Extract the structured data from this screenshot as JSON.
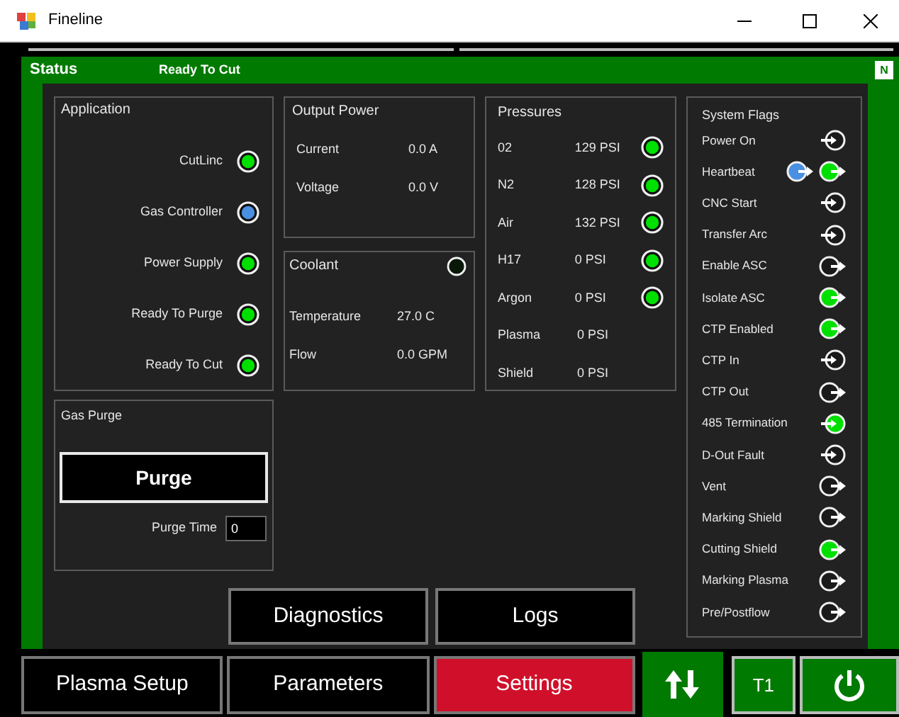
{
  "window": {
    "title": "Fineline"
  },
  "header": {
    "title": "Status",
    "status": "Ready To Cut",
    "badge": "N"
  },
  "application": {
    "title": "Application",
    "items": [
      {
        "label": "CutLinc",
        "color": "#00e000"
      },
      {
        "label": "Gas Controller",
        "color": "#4a90e2"
      },
      {
        "label": "Power Supply",
        "color": "#00e000"
      },
      {
        "label": "Ready To Purge",
        "color": "#00e000"
      },
      {
        "label": "Ready To Cut",
        "color": "#00e000"
      }
    ]
  },
  "output_power": {
    "title": "Output Power",
    "rows": [
      {
        "label": "Current",
        "value": "0.0 A"
      },
      {
        "label": "Voltage",
        "value": "0.0 V"
      }
    ]
  },
  "coolant": {
    "title": "Coolant",
    "color": "#0a180a",
    "rows": [
      {
        "label": "Temperature",
        "value": "27.0 C"
      },
      {
        "label": "Flow",
        "value": "0.0 GPM"
      }
    ]
  },
  "pressures": {
    "title": "Pressures",
    "rows": [
      {
        "label": "02",
        "value": "129 PSI",
        "color": "#00e000"
      },
      {
        "label": "N2",
        "value": "128 PSI",
        "color": "#00e000"
      },
      {
        "label": "Air",
        "value": "132 PSI",
        "color": "#00e000"
      },
      {
        "label": "H17",
        "value": "0 PSI",
        "color": "#00e000"
      },
      {
        "label": "Argon",
        "value": "0 PSI",
        "color": "#00e000"
      },
      {
        "label": "Plasma",
        "value": "0 PSI"
      },
      {
        "label": "Shield",
        "value": "0 PSI"
      }
    ]
  },
  "system_flags": {
    "title": "System Flags",
    "items": [
      {
        "label": "Power On",
        "indicators": [
          {
            "kind": "in",
            "color": "#1a1a1a"
          }
        ]
      },
      {
        "label": "Heartbeat",
        "indicators": [
          {
            "kind": "out",
            "color": "#4a90e2"
          },
          {
            "kind": "out",
            "color": "#00e000"
          }
        ]
      },
      {
        "label": "CNC Start",
        "indicators": [
          {
            "kind": "in",
            "color": "#1a1a1a"
          }
        ]
      },
      {
        "label": "Transfer Arc",
        "indicators": [
          {
            "kind": "in",
            "color": "#1a1a1a"
          }
        ]
      },
      {
        "label": "Enable ASC",
        "indicators": [
          {
            "kind": "out",
            "color": "#1a1a1a"
          }
        ]
      },
      {
        "label": "Isolate ASC",
        "indicators": [
          {
            "kind": "out",
            "color": "#00e000"
          }
        ]
      },
      {
        "label": "CTP Enabled",
        "indicators": [
          {
            "kind": "out",
            "color": "#00e000"
          }
        ]
      },
      {
        "label": "CTP In",
        "indicators": [
          {
            "kind": "in",
            "color": "#1a1a1a"
          }
        ]
      },
      {
        "label": "CTP Out",
        "indicators": [
          {
            "kind": "out",
            "color": "#1a1a1a"
          }
        ]
      },
      {
        "label": "485 Termination",
        "indicators": [
          {
            "kind": "in",
            "color": "#00e000"
          }
        ]
      },
      {
        "label": "D-Out Fault",
        "indicators": [
          {
            "kind": "in",
            "color": "#1a1a1a"
          }
        ]
      },
      {
        "label": "Vent",
        "indicators": [
          {
            "kind": "out",
            "color": "#1a1a1a"
          }
        ]
      },
      {
        "label": "Marking Shield",
        "indicators": [
          {
            "kind": "out",
            "color": "#1a1a1a"
          }
        ]
      },
      {
        "label": "Cutting Shield",
        "indicators": [
          {
            "kind": "out",
            "color": "#00e000"
          }
        ]
      },
      {
        "label": "Marking Plasma",
        "indicators": [
          {
            "kind": "out",
            "color": "#1a1a1a"
          }
        ]
      },
      {
        "label": "Pre/Postflow",
        "indicators": [
          {
            "kind": "out",
            "color": "#1a1a1a"
          }
        ]
      }
    ]
  },
  "gas_purge": {
    "title": "Gas Purge",
    "button": "Purge",
    "time_label": "Purge Time",
    "time_value": "0"
  },
  "sub_buttons": [
    {
      "label": "Diagnostics"
    },
    {
      "label": "Logs"
    }
  ],
  "nav": [
    {
      "label": "Plasma Setup",
      "selected": false
    },
    {
      "label": "Parameters",
      "selected": false
    },
    {
      "label": "Settings",
      "selected": true
    }
  ],
  "tool_button": "T1"
}
